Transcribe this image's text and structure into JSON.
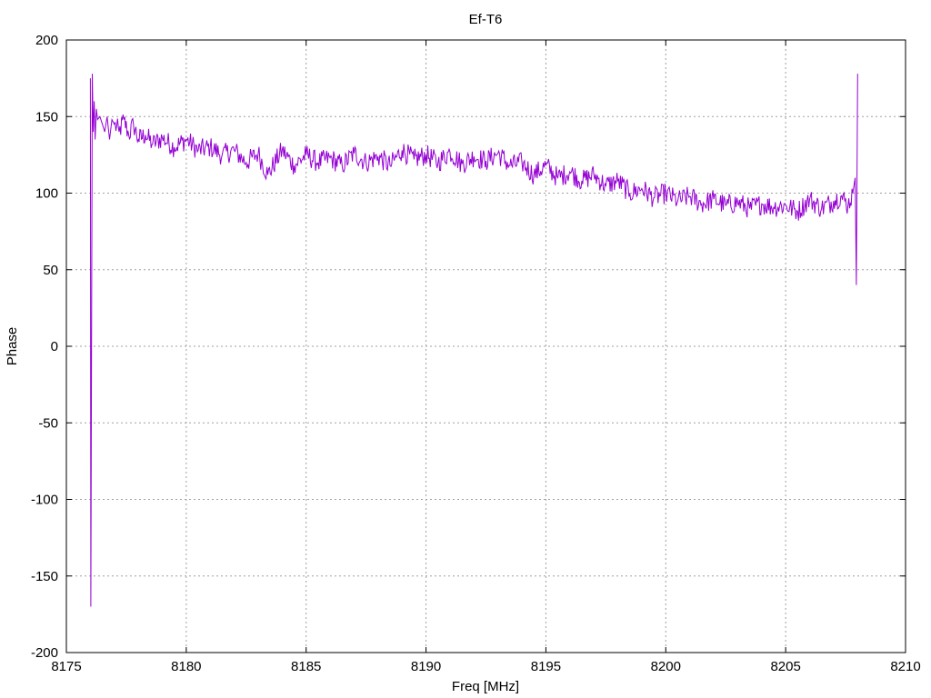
{
  "chart_data": {
    "type": "line",
    "title": "Ef-T6",
    "xlabel": "Freq [MHz]",
    "ylabel": "Phase",
    "xlim": [
      8175,
      8210
    ],
    "ylim": [
      -200,
      200
    ],
    "xticks": [
      8175,
      8180,
      8185,
      8190,
      8195,
      8200,
      8205,
      8210
    ],
    "yticks": [
      -200,
      -150,
      -100,
      -50,
      0,
      50,
      100,
      150,
      200
    ],
    "grid": true,
    "legend": "none",
    "series": [
      {
        "color": "#9400d3",
        "x": [
          8176.0,
          8176.02,
          8176.05,
          8176.08,
          8176.12,
          8176.16,
          8176.2,
          8176.25,
          8176.3,
          8176.4,
          8176.5,
          8176.6,
          8176.7,
          8176.8,
          8176.9,
          8177.0,
          8177.2,
          8177.4,
          8177.6,
          8177.8,
          8178.0,
          8178.3,
          8178.6,
          8179.0,
          8179.5,
          8180.0,
          8180.5,
          8181.0,
          8181.5,
          8182.0,
          8182.5,
          8183.0,
          8183.4,
          8184.0,
          8184.5,
          8185.0,
          8185.5,
          8186.0,
          8186.5,
          8187.0,
          8187.5,
          8188.0,
          8188.5,
          8189.0,
          8189.5,
          8190.0,
          8190.5,
          8191.0,
          8191.5,
          8192.0,
          8192.5,
          8193.0,
          8193.5,
          8194.0,
          8194.5,
          8195.0,
          8195.5,
          8196.0,
          8196.5,
          8197.0,
          8197.5,
          8198.0,
          8198.5,
          8199.0,
          8199.5,
          8200.0,
          8200.5,
          8201.0,
          8201.5,
          8202.0,
          8202.5,
          8203.0,
          8203.5,
          8204.0,
          8204.5,
          8205.0,
          8205.5,
          8206.0,
          8206.5,
          8207.0,
          8207.3,
          8207.6,
          8207.8,
          8207.9,
          8207.95,
          8208.0
        ],
        "y": [
          175,
          -170,
          5,
          178,
          140,
          160,
          135,
          155,
          148,
          150,
          145,
          140,
          150,
          135,
          148,
          145,
          140,
          148,
          138,
          145,
          135,
          138,
          132,
          136,
          130,
          135,
          128,
          130,
          125,
          128,
          120,
          126,
          112,
          128,
          118,
          125,
          120,
          123,
          118,
          126,
          120,
          124,
          118,
          128,
          122,
          125,
          120,
          127,
          119,
          124,
          121,
          126,
          118,
          120,
          112,
          118,
          110,
          114,
          108,
          112,
          105,
          108,
          100,
          103,
          97,
          100,
          95,
          98,
          93,
          96,
          92,
          94,
          90,
          93,
          91,
          92,
          88,
          96,
          90,
          95,
          98,
          92,
          100,
          110,
          40,
          178
        ]
      }
    ]
  }
}
